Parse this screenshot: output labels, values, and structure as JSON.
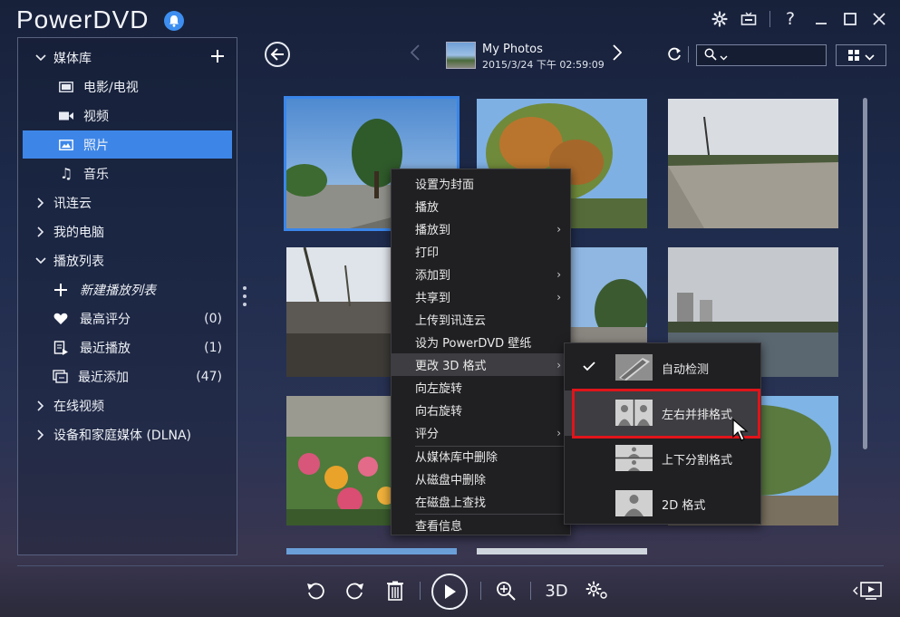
{
  "app": {
    "title": "PowerDVD"
  },
  "sidebar": {
    "library_label": "媒体库",
    "items": [
      {
        "label": "电影/电视",
        "icon": "film-icon"
      },
      {
        "label": "视频",
        "icon": "video-camera-icon"
      },
      {
        "label": "照片",
        "icon": "photo-icon"
      },
      {
        "label": "音乐",
        "icon": "music-note-icon"
      }
    ],
    "cloud_label": "讯连云",
    "computer_label": "我的电脑",
    "playlist_label": "播放列表",
    "playlists": [
      {
        "label": "新建播放列表",
        "count": "",
        "icon": "plus-icon"
      },
      {
        "label": "最高评分",
        "count": "(0)",
        "icon": "heart-icon"
      },
      {
        "label": "最近播放",
        "count": "(1)",
        "icon": "recent-play-icon"
      },
      {
        "label": "最近添加",
        "count": "(47)",
        "icon": "recent-add-icon"
      }
    ],
    "online_label": "在线视频",
    "dlna_label": "设备和家庭媒体 (DLNA)"
  },
  "header": {
    "album_title": "My Photos",
    "album_date": "2015/3/24 下午 02:59:09",
    "search_placeholder": ""
  },
  "context_menu": {
    "items": [
      {
        "label": "设置为封面",
        "submenu": false
      },
      {
        "label": "播放",
        "submenu": false
      },
      {
        "label": "播放到",
        "submenu": true
      },
      {
        "label": "打印",
        "submenu": false
      },
      {
        "label": "添加到",
        "submenu": true
      },
      {
        "label": "共享到",
        "submenu": true
      },
      {
        "label": "上传到讯连云",
        "submenu": false
      },
      {
        "label": "设为 PowerDVD 壁纸",
        "submenu": false
      },
      {
        "label": "更改 3D 格式",
        "submenu": true,
        "highlighted": true
      },
      {
        "label": "向左旋转",
        "submenu": false
      },
      {
        "label": "向右旋转",
        "submenu": false
      },
      {
        "label": "评分",
        "submenu": true
      },
      {
        "label": "从媒体库中删除",
        "submenu": false
      },
      {
        "label": "从磁盘中删除",
        "submenu": false
      },
      {
        "label": "在磁盘上查找",
        "submenu": false
      },
      {
        "label": "查看信息",
        "submenu": false
      }
    ],
    "submenu_3d": [
      {
        "label": "自动检测",
        "checked": true
      },
      {
        "label": "左右并排格式",
        "checked": false,
        "highlighted": true
      },
      {
        "label": "上下分割格式",
        "checked": false
      },
      {
        "label": "2D 格式",
        "checked": false
      }
    ]
  },
  "toolbar": {
    "three_d_label": "3D"
  },
  "colors": {
    "accent": "#3d86e8",
    "highlight_box": "#e0141a",
    "menu_bg": "#202023"
  }
}
